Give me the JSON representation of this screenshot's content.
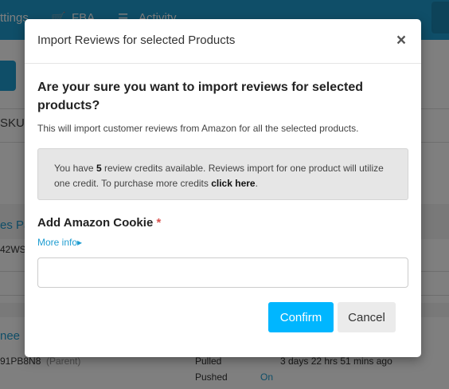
{
  "background": {
    "topbar": {
      "left_fragment": "ttings",
      "fba": "FBA",
      "activity": "Activity"
    },
    "sku_fragment": "SKU",
    "rows": {
      "link1": "es Pa",
      "code1": "42WS",
      "link2": "nee",
      "code2": "91PB8N8",
      "parent_tag": "(Parent)",
      "pulled_label": "Pulled",
      "pushed_label": "Pushed",
      "pushed_value": "On",
      "pulled_time": "3 days 22 hrs 51 mins ago"
    }
  },
  "modal": {
    "title": "Import Reviews for selected Products",
    "close_glyph": "×",
    "question": "Are your sure you want to import reviews for selected products?",
    "subtext": "This will import customer reviews from Amazon for all the selected products.",
    "info": {
      "prefix": "You have ",
      "credits": "5",
      "middle": " review credits available. Reviews import for one product will utilize one credit. To purchase more credits ",
      "link": "click here",
      "suffix": "."
    },
    "cookie_label": "Add Amazon Cookie",
    "required_mark": "*",
    "more_info": "More info",
    "more_info_arrow": "▸",
    "cookie_value": "",
    "confirm_label": "Confirm",
    "cancel_label": "Cancel"
  }
}
